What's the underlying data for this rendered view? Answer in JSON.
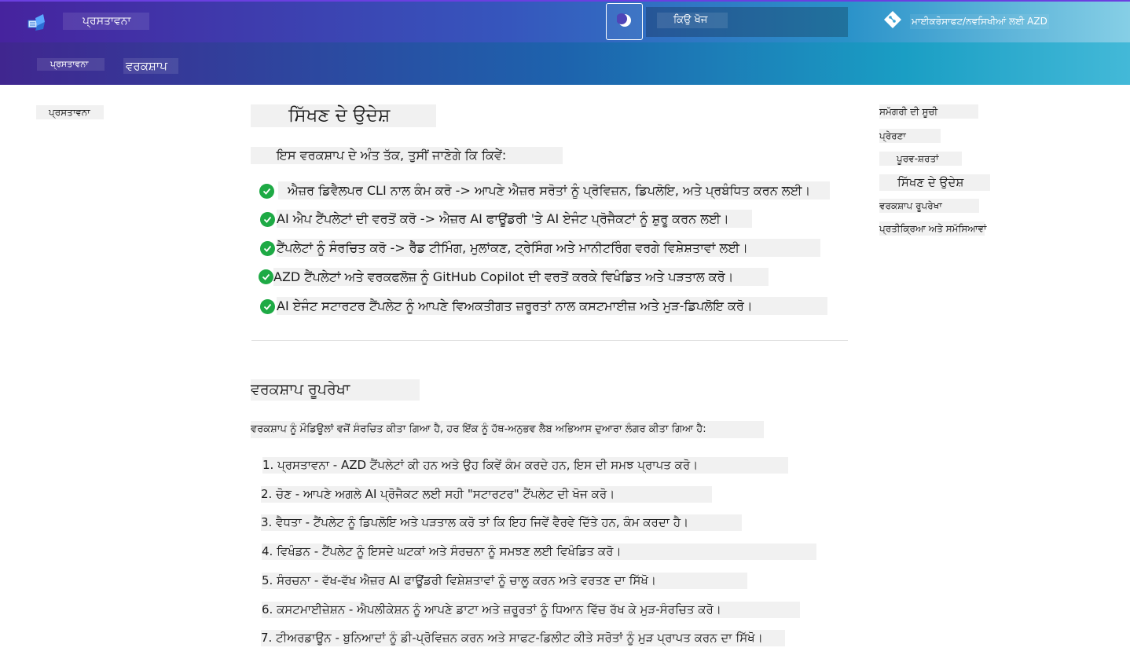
{
  "header": {
    "site_title": "ਪ੍ਰਸਤਾਵਨਾ",
    "search_label": "ਕਿਉ ਖੋਜ",
    "repo_label": "ਮਾਈਕਰੋਸਾਫਟ/ਨਵਸਿਖੀਆਂ ਲਈ AZD",
    "tabs": [
      {
        "label": "ਪ੍ਰਸਤਾਵਨਾ"
      },
      {
        "label": "ਵਰਕਸ਼ਾਪ"
      }
    ]
  },
  "sidebar": {
    "items": [
      {
        "label": "ਪ੍ਰਸਤਾਵਨਾ"
      }
    ]
  },
  "main": {
    "title": "ਸਿੱਖਣ ਦੇ ਉਦੇਸ਼",
    "intro": "ਇਸ ਵਰਕਸ਼ਾਪ ਦੇ ਅੰਤ ਤੱਕ, ਤੁਸੀਂ ਜਾਣੋਗੇ ਕਿ ਕਿਵੇਂ:",
    "objectives": [
      "ਐਜ਼ਰ ਡਿਵੈਲਪਰ CLI ਨਾਲ ਕੰਮ ਕਰੋ -> ਆਪਣੇ ਐਜ਼ਰ ਸਰੋਤਾਂ ਨੂੰ ਪ੍ਰੋਵਿਜ਼ਨ, ਡਿਪਲੋਇ, ਅਤੇ ਪ੍ਰਬੰਧਿਤ ਕਰਨ ਲਈ।",
      "AI ਐਪ ਟੈਂਪਲੇਟਾਂ ਦੀ ਵਰਤੋਂ ਕਰੋ -> ਐਜ਼ਰ AI ਫਾਊਂਡਰੀ 'ਤੇ AI ਏਜੰਟ ਪ੍ਰੋਜੈਕਟਾਂ ਨੂੰ ਸ਼ੁਰੂ ਕਰਨ ਲਈ।",
      "ਟੈਂਪਲੇਟਾਂ ਨੂੰ ਸੰਰਚਿਤ ਕਰੋ -> ਰੈੱਡ ਟੀਮਿੰਗ, ਮੁਲਾਂਕਣ, ਟ੍ਰੇਸਿੰਗ ਅਤੇ ਮਾਨੀਟਰਿੰਗ ਵਰਗੇ ਵਿਸ਼ੇਸ਼ਤਾਵਾਂ ਲਈ।",
      "AZD ਟੈਂਪਲੇਟਾਂ ਅਤੇ ਵਰਕਫਲੋਜ਼ ਨੂੰ GitHub Copilot ਦੀ ਵਰਤੋਂ ਕਰਕੇ ਵਿਖੰਡਿਤ ਅਤੇ ਪੜਤਾਲ ਕਰੋ।",
      "AI ਏਜੰਟ ਸਟਾਰਟਰ ਟੈਂਪਲੇਟ ਨੂੰ ਆਪਣੇ ਵਿਅਕਤੀਗਤ ਜ਼ਰੂਰਤਾਂ ਨਾਲ ਕਸਟਮਾਈਜ਼ ਅਤੇ ਮੁੜ-ਡਿਪਲੋਇ ਕਰੋ।"
    ],
    "outline_title": "ਵਰਕਸ਼ਾਪ ਰੂਪਰੇਖਾ",
    "outline_desc": "ਵਰਕਸ਼ਾਪ ਨੂੰ ਮੌਡਿਊਲਾਂ ਵਜੋਂ ਸੰਰਚਿਤ ਕੀਤਾ ਗਿਆ ਹੈ, ਹਰ ਇੱਕ ਨੂੰ ਹੱਥ-ਅਨੁਭਵ ਲੈਬ ਅਭਿਆਸ ਦੁਆਰਾ ਲੰਗਰ ਕੀਤਾ ਗਿਆ ਹੈ:",
    "steps": [
      "1. ਪ੍ਰਸਤਾਵਨਾ - AZD ਟੈਂਪਲੇਟਾਂ ਕੀ ਹਨ ਅਤੇ ਉਹ ਕਿਵੇਂ ਕੰਮ ਕਰਦੇ ਹਨ, ਇਸ ਦੀ ਸਮਝ ਪ੍ਰਾਪਤ ਕਰੋ।",
      "2. ਚੋਣ - ਆਪਣੇ ਅਗਲੇ AI ਪ੍ਰੋਜੈਕਟ ਲਈ ਸਹੀ \"ਸਟਾਰਟਰ\" ਟੈਂਪਲੇਟ ਦੀ ਖੋਜ ਕਰੋ।",
      "3. ਵੈਧਤਾ - ਟੈਂਪਲੇਟ ਨੂੰ ਡਿਪਲੋਇ ਅਤੇ ਪੜਤਾਲ ਕਰੋ ਤਾਂ ਕਿ ਇਹ ਜਿਵੇਂ ਵੈਰਵੇ ਦਿੱਤੇ ਹਨ, ਕੰਮ ਕਰਦਾ ਹੈ।",
      "4. ਵਿਖੰਡਨ - ਟੈਂਪਲੇਟ ਨੂੰ ਇਸਦੇ ਘਟਕਾਂ ਅਤੇ ਸੰਰਚਨਾ ਨੂੰ ਸਮਝਣ ਲਈ ਵਿਖੰਡਿਤ ਕਰੋ।",
      "5. ਸੰਰਚਨਾ - ਵੱਖ-ਵੱਖ ਐਜ਼ਰ AI ਫਾਊਂਡਰੀ ਵਿਸ਼ੇਸ਼ਤਾਵਾਂ ਨੂੰ ਚਾਲੂ ਕਰਨ ਅਤੇ ਵਰਤਣ ਦਾ ਸਿੱਖੋ।",
      "6. ਕਸਟਮਾਈਜ਼ੇਸ਼ਨ - ਐਪਲੀਕੇਸ਼ਨ ਨੂੰ ਆਪਣੇ ਡਾਟਾ ਅਤੇ ਜ਼ਰੂਰਤਾਂ ਨੂੰ ਧਿਆਨ ਵਿੱਚ ਰੱਖ ਕੇ ਮੁੜ-ਸੰਰਚਿਤ ਕਰੋ।",
      "7. ਟੀਅਰਡਾਊਨ - ਬੁਨਿਆਦਾਂ ਨੂੰ ਡੀ-ਪ੍ਰੋਵਿਜ਼ਨ ਕਰਨ ਅਤੇ ਸਾਫਟ-ਡਿਲੀਟ ਕੀਤੇ ਸਰੋਤਾਂ ਨੂੰ ਮੁੜ ਪ੍ਰਾਪਤ ਕਰਨ ਦਾ ਸਿੱਖੋ।"
    ]
  },
  "toc": {
    "title": "ਸਮੱਗਰੀ ਦੀ ਸੂਚੀ",
    "items": [
      {
        "label": "ਪ੍ਰੇਰਣਾ"
      },
      {
        "label": "ਪੂਰਵ-ਸ਼ਰਤਾਂ"
      },
      {
        "label": "ਸਿੱਖਣ ਦੇ ਉਦੇਸ਼"
      },
      {
        "label": "ਵਰਕਸ਼ਾਪ ਰੂਪਰੇਖਾ"
      },
      {
        "label": "ਪ੍ਰਤੀਕ੍ਰਿਆ ਅਤੇ ਸਮੱਸਿਆਵਾਂ"
      }
    ]
  },
  "icons": {
    "logo": "azd-logo-icon",
    "theme_toggle": "moon-icon",
    "repo": "git-diamond-icon",
    "objective": "check-circle-icon"
  },
  "colors": {
    "header_start": "#46239e",
    "header_end": "#86cfe6",
    "check_green": "#1eaa45"
  }
}
